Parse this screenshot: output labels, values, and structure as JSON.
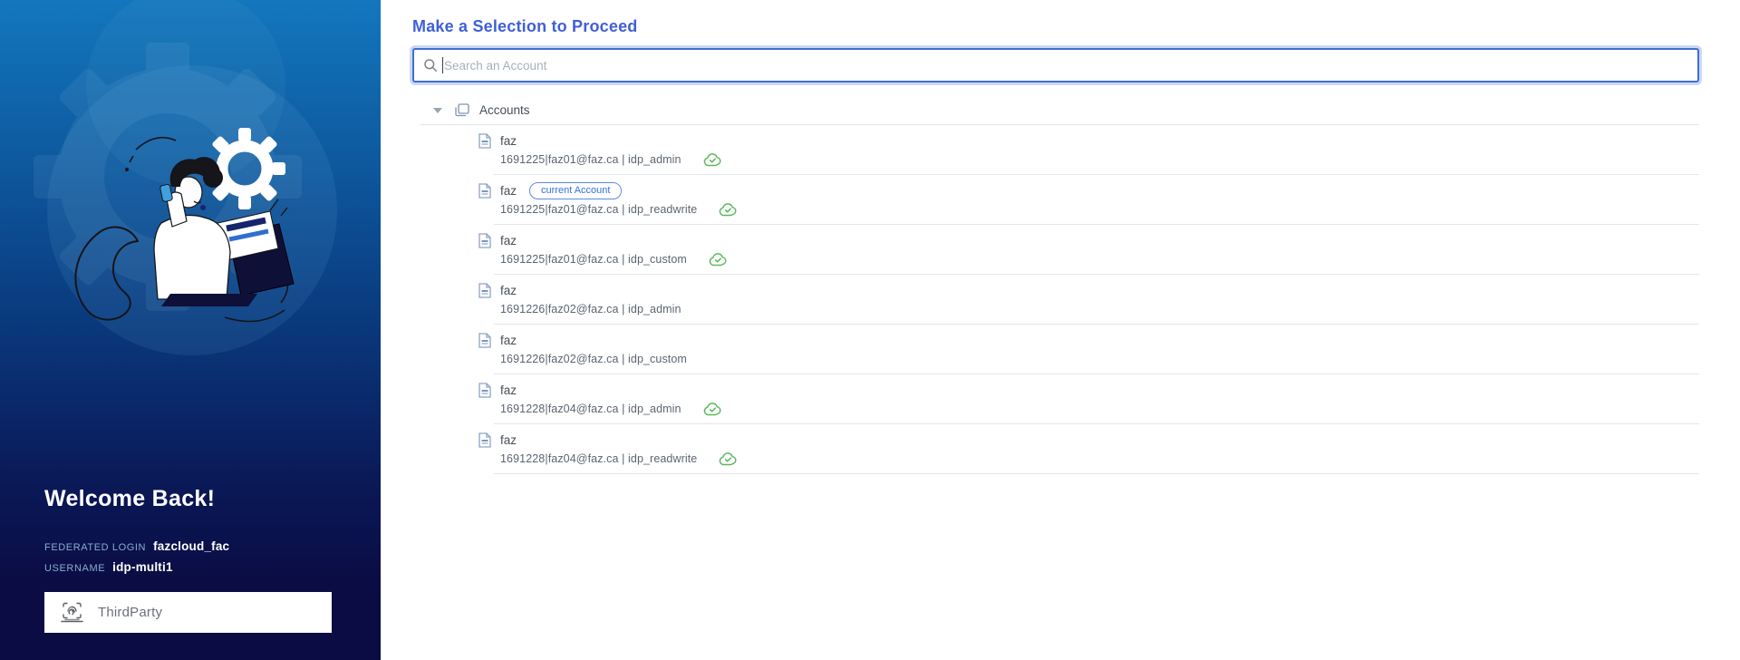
{
  "sidebar": {
    "welcome_title": "Welcome Back!",
    "federated_login": {
      "label": "FEDERATED LOGIN",
      "value": "fazcloud_fac"
    },
    "username": {
      "label": "USERNAME",
      "value": "idp-multi1"
    },
    "third_party": {
      "label": "ThirdParty",
      "icon": "fingerprint-scanner-icon"
    },
    "illustration": "support-agent-with-laptop-and-gear",
    "colors": {
      "gradient_top": "#1377bd",
      "gradient_bottom": "#0b0c44"
    }
  },
  "main": {
    "title": "Make a Selection to Proceed",
    "search": {
      "placeholder": "Search an Account",
      "value": "",
      "icon": "search-icon"
    },
    "badge_label": "current Account",
    "tree": {
      "root": {
        "label": "Accounts",
        "icon": "accounts-collection-icon",
        "state": "expanded"
      },
      "accounts": [
        {
          "name": "faz",
          "detail": "1691225|faz01@faz.ca | idp_admin",
          "cloud": true,
          "current": false
        },
        {
          "name": "faz",
          "detail": "1691225|faz01@faz.ca | idp_readwrite",
          "cloud": true,
          "current": true
        },
        {
          "name": "faz",
          "detail": "1691225|faz01@faz.ca | idp_custom",
          "cloud": true,
          "current": false
        },
        {
          "name": "faz",
          "detail": "1691226|faz02@faz.ca | idp_admin",
          "cloud": false,
          "current": false
        },
        {
          "name": "faz",
          "detail": "1691226|faz02@faz.ca | idp_custom",
          "cloud": false,
          "current": false
        },
        {
          "name": "faz",
          "detail": "1691228|faz04@faz.ca | idp_admin",
          "cloud": true,
          "current": false
        },
        {
          "name": "faz",
          "detail": "1691228|faz04@faz.ca | idp_readwrite",
          "cloud": true,
          "current": false
        }
      ]
    },
    "colors": {
      "title": "#3f5fd8",
      "search_border": "#3f6ed5",
      "badge": "#3c6fd8",
      "cloud_icon": "#5cb85c",
      "separator": "#e2e6eb"
    }
  }
}
